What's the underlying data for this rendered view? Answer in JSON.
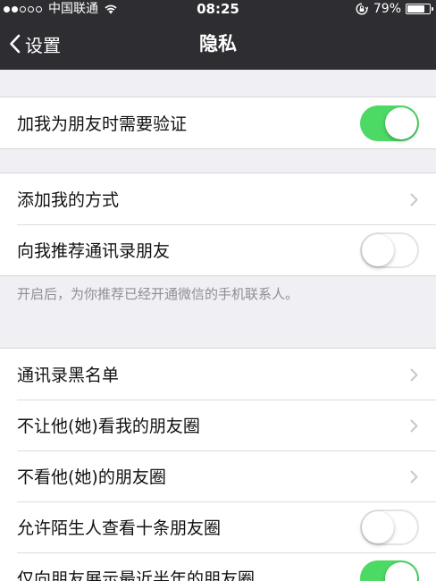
{
  "status_bar": {
    "carrier": "中国联通",
    "signal_dots_filled": 2,
    "signal_dots_total": 5,
    "time": "08:25",
    "battery_percent": "79%",
    "battery_level": 0.79
  },
  "nav": {
    "back_label": "设置",
    "title": "隐私"
  },
  "colors": {
    "nav_background": "#2e2e32",
    "toggle_on": "#4cd964",
    "page_background": "#efeff4"
  },
  "section1": {
    "verify": {
      "label": "加我为朋友时需要验证",
      "toggle_on": true
    }
  },
  "section2": {
    "add_methods": {
      "label": "添加我的方式"
    },
    "recommend_contacts": {
      "label": "向我推荐通讯录朋友",
      "toggle_on": false
    },
    "footnote": "开启后，为你推荐已经开通微信的手机联系人。"
  },
  "section3": {
    "blacklist": {
      "label": "通讯录黑名单"
    },
    "hide_moments": {
      "label": "不让他(她)看我的朋友圈"
    },
    "dont_see_moments": {
      "label": "不看他(她)的朋友圈"
    },
    "stranger_ten": {
      "label": "允许陌生人查看十条朋友圈",
      "toggle_on": false
    },
    "half_year": {
      "label": "仅向朋友展示最近半年的朋友圈",
      "toggle_on": true
    }
  }
}
